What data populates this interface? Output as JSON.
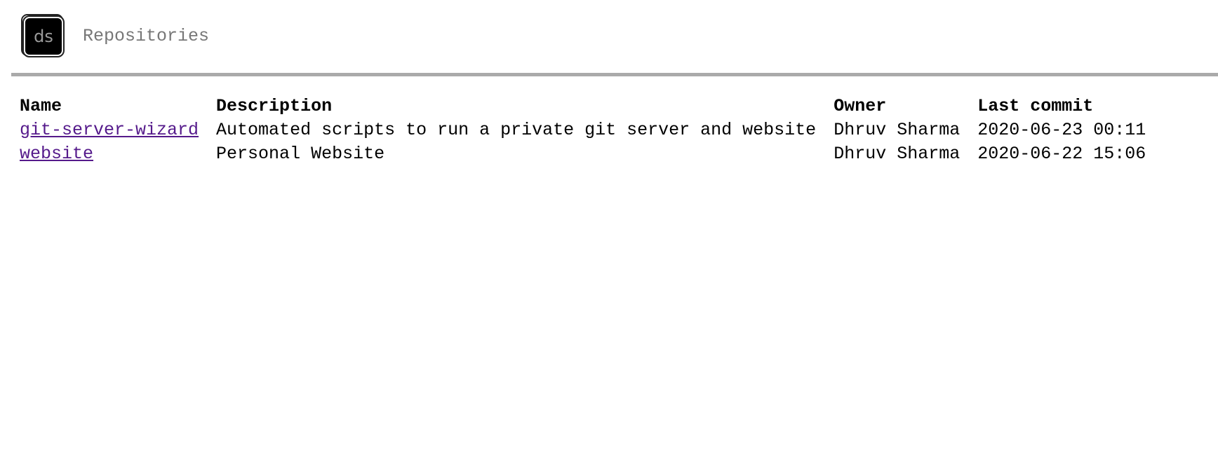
{
  "header": {
    "logo_text": "ds",
    "title": "Repositories"
  },
  "repos": {
    "columns": [
      "Name",
      "Description",
      "Owner",
      "Last commit"
    ],
    "rows": [
      {
        "name": "git-server-wizard",
        "description": "Automated scripts to run a private git server and website",
        "owner": "Dhruv Sharma",
        "last_commit": "2020-06-23 00:11"
      },
      {
        "name": "website",
        "description": "Personal Website",
        "owner": "Dhruv Sharma",
        "last_commit": "2020-06-22 15:06"
      }
    ]
  },
  "colors": {
    "link": "#551a8b",
    "title": "#777777",
    "divider": "#aaaaaa",
    "logo_bg": "#000000"
  }
}
